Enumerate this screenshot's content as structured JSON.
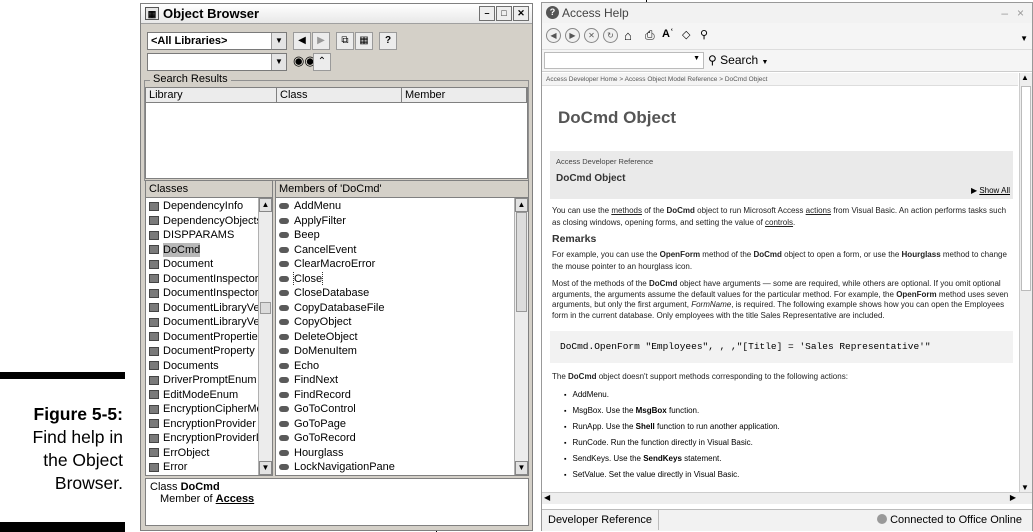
{
  "caption": {
    "figure": "Figure 5-5:",
    "line1": "Find help in",
    "line2": "the Object",
    "line3": "Browser."
  },
  "object_browser": {
    "title": "Object Browser",
    "library_combo": "<All Libraries>",
    "search_combo": "",
    "tool_icons": [
      "back-icon",
      "forward-icon",
      "copy-icon",
      "view-definition-icon",
      "help-icon",
      "binoculars-icon",
      "collapse-icon"
    ],
    "search_results_label": "Search Results",
    "results_columns": [
      "Library",
      "Class",
      "Member"
    ],
    "classes_header": "Classes",
    "members_header": "Members of 'DoCmd'",
    "classes": [
      {
        "label": "DependencyInfo"
      },
      {
        "label": "DependencyObjects"
      },
      {
        "label": "DISPPARAMS"
      },
      {
        "label": "DoCmd"
      },
      {
        "label": "Document"
      },
      {
        "label": "DocumentInspector"
      },
      {
        "label": "DocumentInspectors"
      },
      {
        "label": "DocumentLibraryVer"
      },
      {
        "label": "DocumentLibraryVer"
      },
      {
        "label": "DocumentProperties"
      },
      {
        "label": "DocumentProperty"
      },
      {
        "label": "Documents"
      },
      {
        "label": "DriverPromptEnum"
      },
      {
        "label": "EditModeEnum"
      },
      {
        "label": "EncryptionCipherMo"
      },
      {
        "label": "EncryptionProvider"
      },
      {
        "label": "EncryptionProviderD"
      },
      {
        "label": "ErrObject"
      },
      {
        "label": "Error"
      }
    ],
    "members": [
      {
        "label": "AddMenu"
      },
      {
        "label": "ApplyFilter"
      },
      {
        "label": "Beep"
      },
      {
        "label": "CancelEvent"
      },
      {
        "label": "ClearMacroError"
      },
      {
        "label": "Close"
      },
      {
        "label": "CloseDatabase"
      },
      {
        "label": "CopyDatabaseFile"
      },
      {
        "label": "CopyObject"
      },
      {
        "label": "DeleteObject"
      },
      {
        "label": "DoMenuItem"
      },
      {
        "label": "Echo"
      },
      {
        "label": "FindNext"
      },
      {
        "label": "FindRecord"
      },
      {
        "label": "GoToControl"
      },
      {
        "label": "GoToPage"
      },
      {
        "label": "GoToRecord"
      },
      {
        "label": "Hourglass"
      },
      {
        "label": "LockNavigationPane"
      }
    ],
    "status": {
      "class_prefix": "Class",
      "class_name": "DoCmd",
      "member_prefix": "Member of",
      "member_of": "Access"
    }
  },
  "access_help": {
    "title": "Access Help",
    "search_label": "Search",
    "breadcrumb": "Access Developer Home > Access Object Model Reference > DoCmd Object",
    "heading": "DoCmd Object",
    "ref_label": "Access Developer Reference",
    "ref_title": "DoCmd Object",
    "show_all": "Show All",
    "intro": {
      "a": "You can use the ",
      "methods": "methods",
      "b": " of the ",
      "docmd": "DoCmd",
      "c": " object to run Microsoft Access ",
      "actions": "actions",
      "d": " from Visual Basic. An action performs tasks such as closing windows, opening forms, and setting the value of ",
      "controls": "controls",
      "e": "."
    },
    "remarks_heading": "Remarks",
    "remarks_p1": {
      "a": "For example, you can use the ",
      "openform": "OpenForm",
      "b": " method of the ",
      "docmd": "DoCmd",
      "c": " object to open a form, or use the ",
      "hourglass": "Hourglass",
      "d": " method to change the mouse pointer to an hourglass icon."
    },
    "remarks_p2": {
      "a": "Most of the methods of the ",
      "docmd": "DoCmd",
      "b": " object have arguments — some are required, while others are optional. If you omit optional arguments, the arguments assume the default values for the particular method. For example, the ",
      "openform": "OpenForm",
      "c": " method uses seven arguments, but only the first argument, ",
      "formname": "FormName",
      "d": ", is required. The following example shows how you can open the Employees form in the current database. Only employees with the title Sales Representative are included."
    },
    "code": "DoCmd.OpenForm \"Employees\", , ,\"[Title] = 'Sales Representative'\"",
    "support_p": {
      "a": "The ",
      "docmd": "DoCmd",
      "b": " object doesn't support methods corresponding to the following actions:"
    },
    "bullets": {
      "b1": "AddMenu.",
      "b2a": "MsgBox. Use the ",
      "b2b": "MsgBox",
      "b2c": " function.",
      "b3a": "RunApp. Use the ",
      "b3b": "Shell",
      "b3c": " function to run another application.",
      "b4": "RunCode. Run the function directly in Visual Basic.",
      "b5a": "SendKeys. Use the ",
      "b5b": "SendKeys",
      "b5c": " statement.",
      "b6": "SetValue. Set the value directly in Visual Basic."
    },
    "status_left": "Developer Reference",
    "status_right": "Connected to Office Online"
  }
}
